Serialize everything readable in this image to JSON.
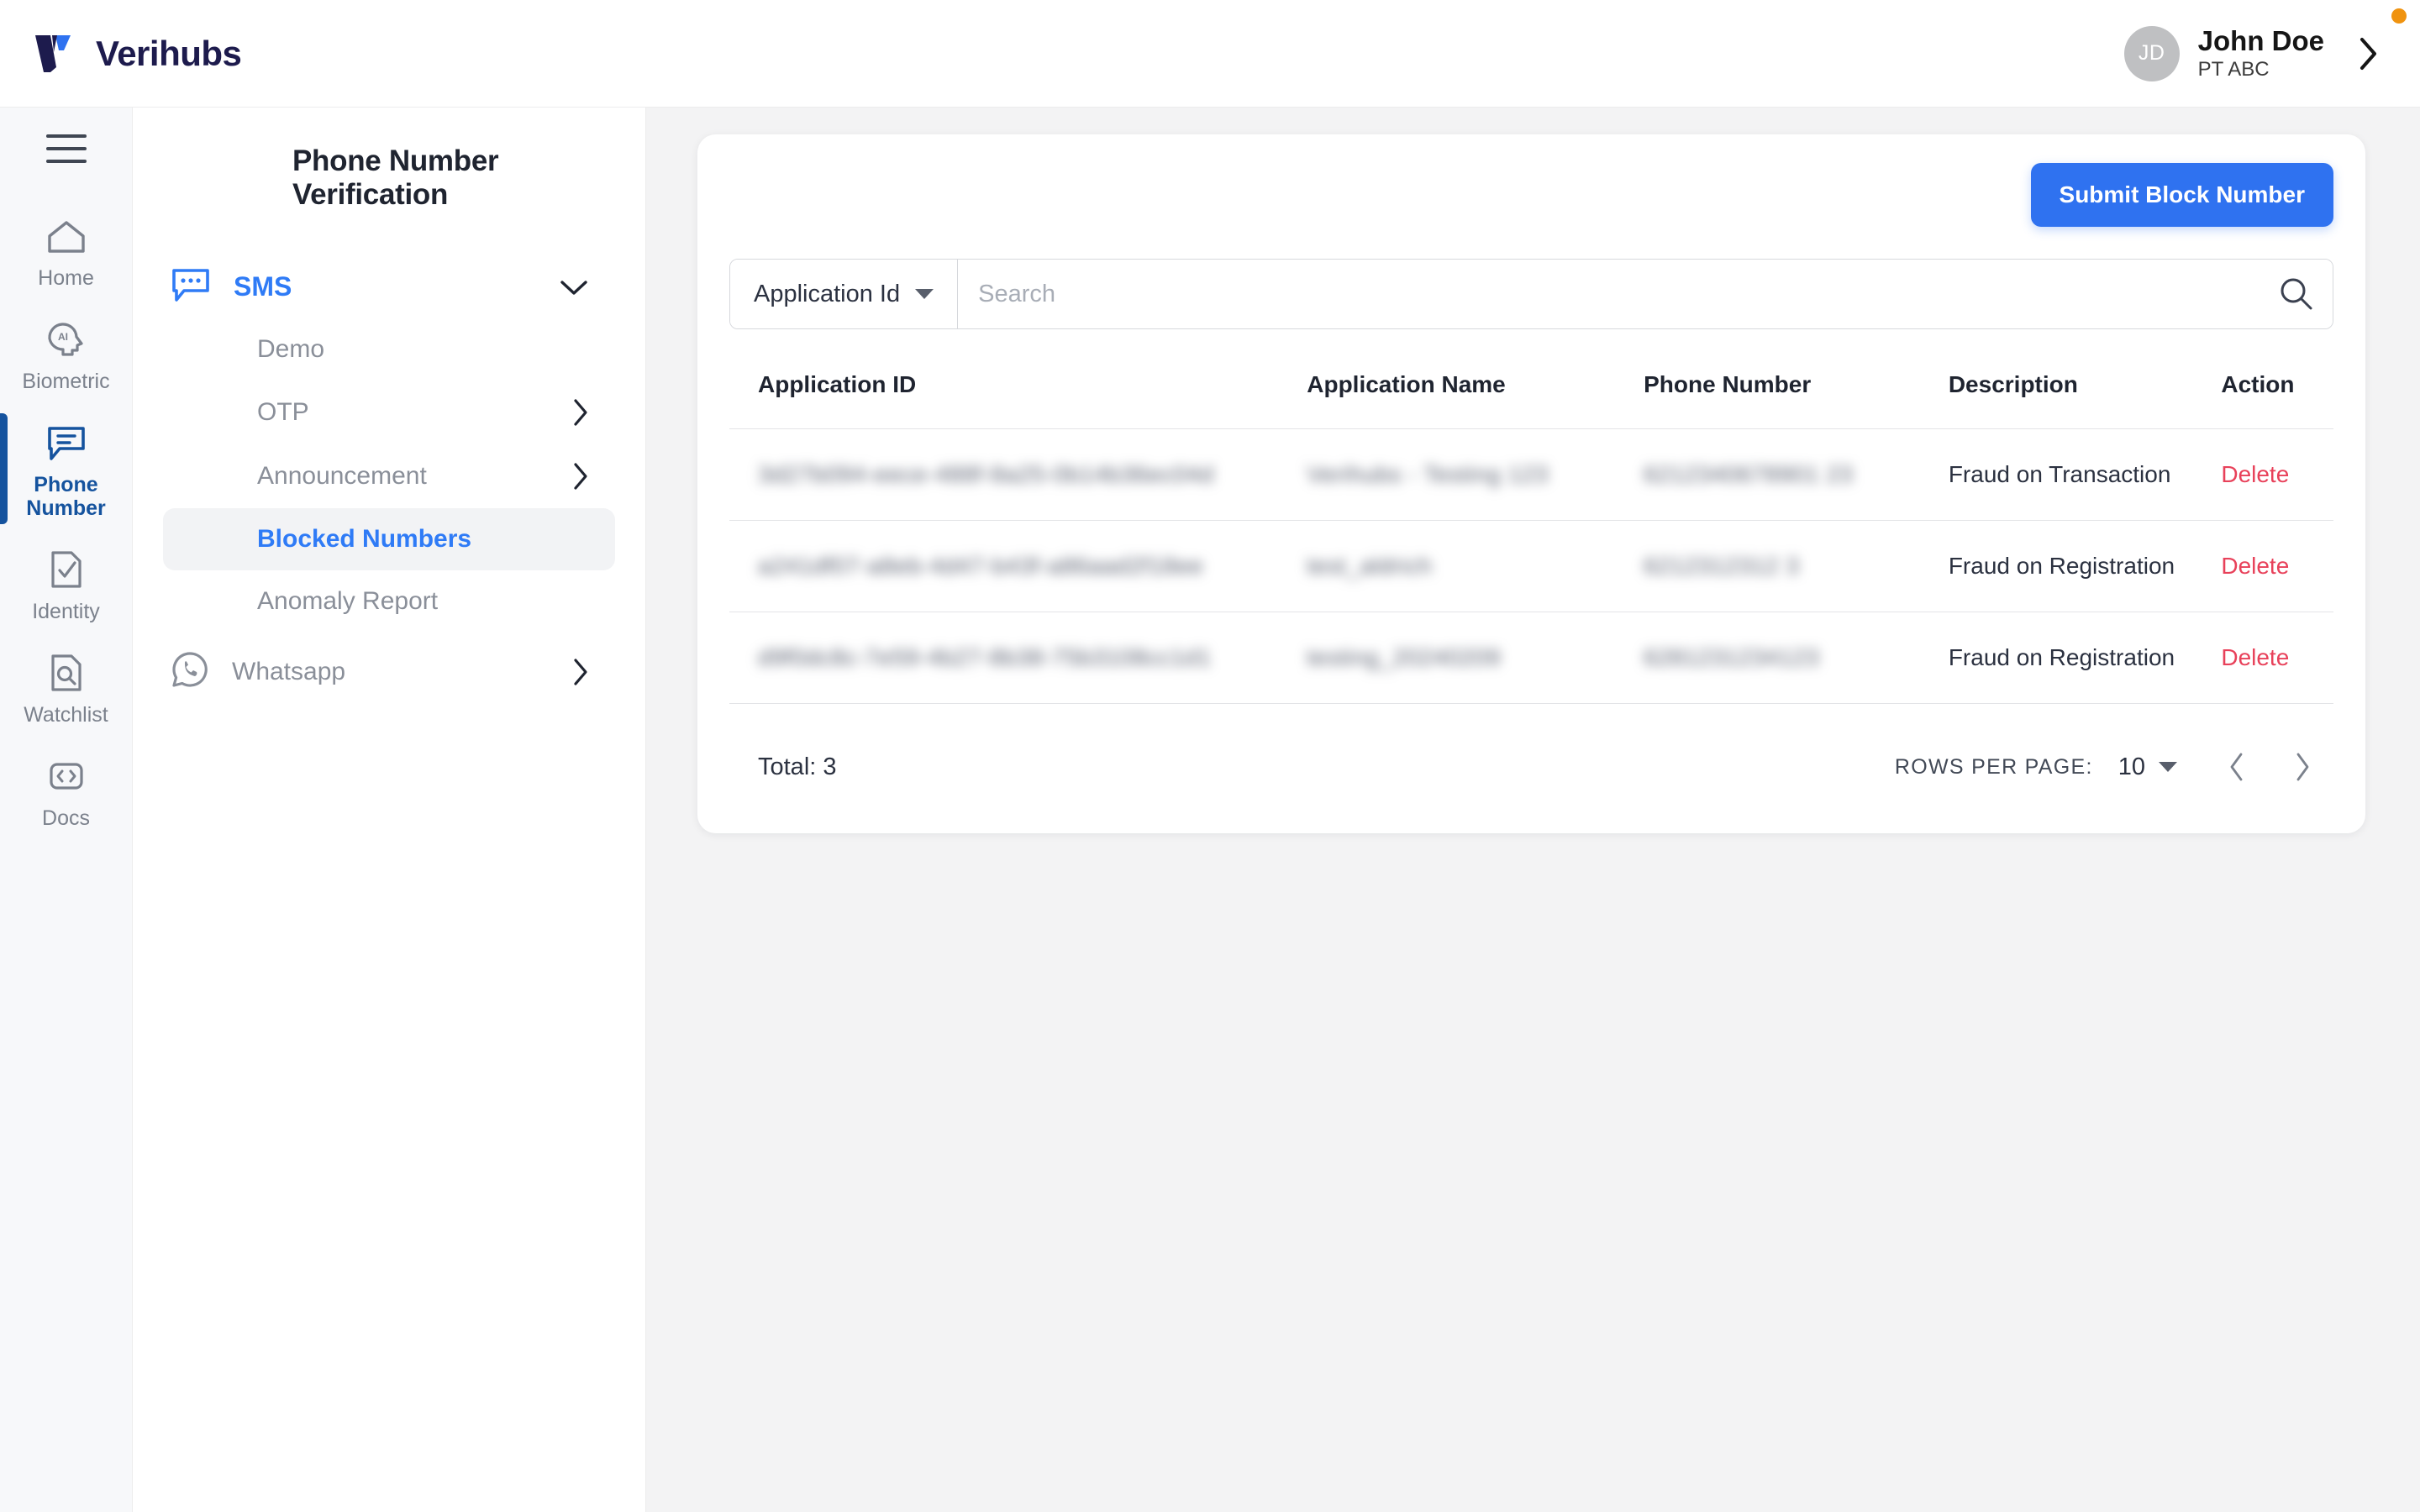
{
  "topbar": {
    "brand_name": "Verihubs",
    "logo_icon": "verihubs-v-logo",
    "logo_color_dark": "#1d1b4d",
    "logo_color_accent": "#2f72f0",
    "user": {
      "initials": "JD",
      "name": "John Doe",
      "org": "PT ABC",
      "chevron_icon": "chevron-right-icon"
    },
    "notification_dot_color": "#f0930f"
  },
  "rail": {
    "menu_icon": "hamburger-menu-icon",
    "items": [
      {
        "label": "Home",
        "icon": "home-icon",
        "active": false
      },
      {
        "label": "Biometric",
        "icon": "ai-face-icon",
        "active": false
      },
      {
        "label": "Phone Number",
        "icon": "message-lines-icon",
        "active": true
      },
      {
        "label": "Identity",
        "icon": "document-check-icon",
        "active": false
      },
      {
        "label": "Watchlist",
        "icon": "document-search-icon",
        "active": false
      },
      {
        "label": "Docs",
        "icon": "code-brackets-icon",
        "active": false
      }
    ],
    "active_color": "#15539e",
    "inactive_color": "#7b818c"
  },
  "subnav": {
    "title": "Phone Number Verification",
    "groups": [
      {
        "label": "SMS",
        "icon": "sms-bubble-icon",
        "expanded": true,
        "chevron_icon": "chevron-down-icon",
        "items": [
          {
            "label": "Demo",
            "active": false,
            "chevron_icon": null
          },
          {
            "label": "OTP",
            "active": false,
            "chevron_icon": "chevron-right-icon"
          },
          {
            "label": "Announcement",
            "active": false,
            "chevron_icon": "chevron-right-icon"
          },
          {
            "label": "Blocked Numbers",
            "active": true,
            "chevron_icon": null
          },
          {
            "label": "Anomaly Report",
            "active": false,
            "chevron_icon": null
          }
        ]
      },
      {
        "label": "Whatsapp",
        "icon": "whatsapp-icon",
        "expanded": false,
        "chevron_icon": "chevron-right-icon",
        "items": []
      }
    ],
    "accent_color": "#2f7bf6"
  },
  "main": {
    "submit_button": "Submit Block Number",
    "submit_button_color": "#2f72f0",
    "search": {
      "filter_label": "Application Id",
      "filter_caret_icon": "caret-down-icon",
      "placeholder": "Search",
      "value": "",
      "search_icon": "search-icon"
    },
    "table": {
      "columns": [
        "Application ID",
        "Application Name",
        "Phone Number",
        "Description",
        "Action"
      ],
      "rows": [
        {
          "application_id": "3d27b094-eece-488f-8a25-0b14b36ec04d",
          "application_name": "Verihubs - Testing 123",
          "phone_number": "6212340678901 23",
          "description": "Fraud on Transaction",
          "action": "Delete",
          "redacted": true
        },
        {
          "application_id": "a241df07-a8eb-4d47-b43f-a86aad2f18ee",
          "application_name": "test_aldrich",
          "phone_number": "6212312312 3",
          "description": "Fraud on Registration",
          "action": "Delete",
          "redacted": true
        },
        {
          "application_id": "d9f0dc8c-7e59-4b27-8b38-75b3108cc1d1",
          "application_name": "testing_20240209",
          "phone_number": "6281231234123",
          "description": "Fraud on Registration",
          "action": "Delete",
          "redacted": true
        }
      ],
      "delete_color": "#e8415a"
    },
    "footer": {
      "total_label": "Total: 3",
      "rows_per_page_label": "ROWS PER PAGE:",
      "rows_per_page_value": "10",
      "rows_caret_icon": "caret-down-icon",
      "prev_icon": "chevron-left-icon",
      "next_icon": "chevron-right-icon"
    }
  }
}
